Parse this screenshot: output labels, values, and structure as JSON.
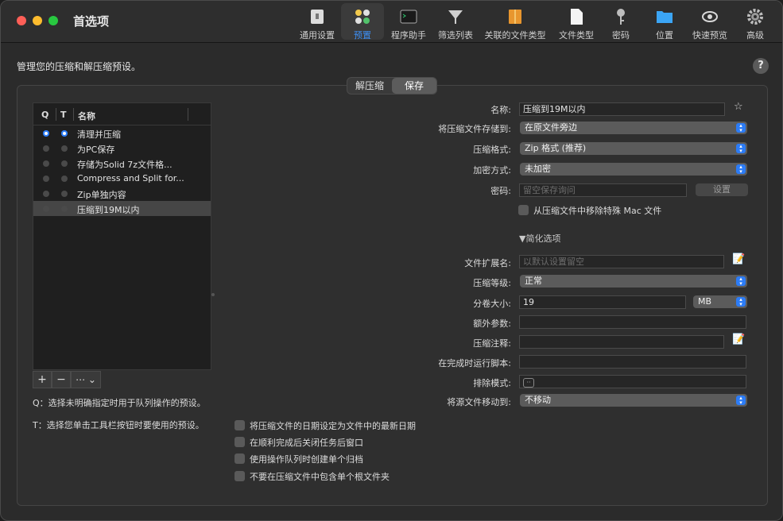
{
  "window": {
    "title": "首选项"
  },
  "toolbar": {
    "items": [
      {
        "label": "通用设置",
        "icon": "general-settings-icon"
      },
      {
        "label": "预置",
        "icon": "presets-icon",
        "active": true
      },
      {
        "label": "程序助手",
        "icon": "terminal-icon"
      },
      {
        "label": "筛选列表",
        "icon": "filter-icon"
      },
      {
        "label": "关联的文件类型",
        "icon": "archive-icon"
      },
      {
        "label": "文件类型",
        "icon": "document-icon"
      },
      {
        "label": "密码",
        "icon": "key-icon"
      },
      {
        "label": "位置",
        "icon": "folder-icon"
      },
      {
        "label": "快速预览",
        "icon": "eye-icon"
      },
      {
        "label": "高级",
        "icon": "gear-icon"
      }
    ]
  },
  "header": {
    "subtitle": "管理您的压缩和解压缩预设。",
    "help": "?"
  },
  "segments": {
    "decompress": "解压缩",
    "save": "保存"
  },
  "list": {
    "headers": {
      "q": "Q",
      "t": "T",
      "name": "名称"
    },
    "rows": [
      {
        "name": "清理并压缩",
        "q": true,
        "t": true,
        "selected": false
      },
      {
        "name": "为PC保存",
        "q": false,
        "t": false,
        "selected": false
      },
      {
        "name": "存储为Solid 7z文件格...",
        "q": false,
        "t": false,
        "selected": false
      },
      {
        "name": "Compress and Split for...",
        "q": false,
        "t": false,
        "selected": false
      },
      {
        "name": "Zip单独内容",
        "q": false,
        "t": false,
        "selected": false
      },
      {
        "name": "压缩到19M以内",
        "q": false,
        "t": false,
        "selected": true
      }
    ],
    "buttons": {
      "add": "+",
      "remove": "−",
      "more": "⋯ ⌄"
    }
  },
  "notes": {
    "q": "Q：选择未明确指定时用于队列操作的预设。",
    "t": "T：选择您单击工具栏按钮时要使用的预设。"
  },
  "form": {
    "name_label": "名称:",
    "name_value": "压缩到19M以内",
    "save_to_label": "将压缩文件存储到:",
    "save_to_value": "在原文件旁边",
    "format_label": "压缩格式:",
    "format_value": "Zip 格式 (推荐)",
    "encryption_label": "加密方式:",
    "encryption_value": "未加密",
    "password_label": "密码:",
    "password_placeholder": "留空保存询问",
    "set_button": "设置",
    "remove_mac_label": "从压缩文件中移除特殊 Mac 文件",
    "simplify_label": "▼简化选项",
    "ext_label": "文件扩展名:",
    "ext_placeholder": "以默认设置留空",
    "level_label": "压缩等级:",
    "level_value": "正常",
    "volume_label": "分卷大小:",
    "volume_value": "19",
    "volume_unit": "MB",
    "extra_label": "额外参数:",
    "extra_value": "",
    "comment_label": "压缩注释:",
    "comment_value": "",
    "script_label": "在完成时运行脚本:",
    "script_value": "",
    "exclude_label": "排除模式:",
    "move_label": "将源文件移动到:",
    "move_value": "不移动"
  },
  "checkboxes": [
    "将压缩文件的日期设定为文件中的最新日期",
    "在顺利完成后关闭任务后窗口",
    "使用操作队列时创建单个归档",
    "不要在压缩文件中包含单个根文件夹"
  ]
}
